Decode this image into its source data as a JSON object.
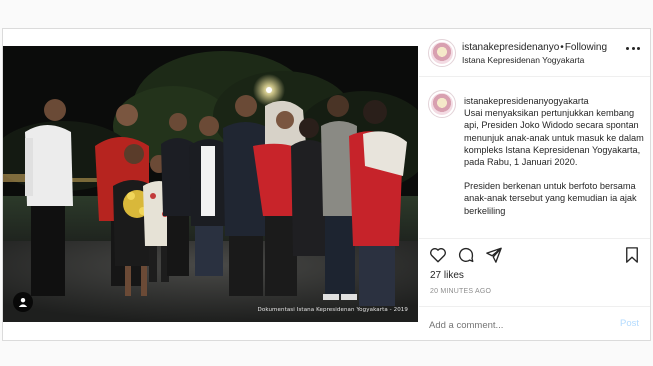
{
  "post": {
    "username": "istanakepresidenanyogyakarta",
    "header_username": "istanakepresidenanyo",
    "follow_label": "Following",
    "separator": "•",
    "location": "Istana Kepresidenan Yogyakarta",
    "caption_username": "istanakepresidenanyogyakarta",
    "caption_p1": "Usai menyaksikan pertunjukkan kembang api, Presiden Joko Widodo secara spontan menunjuk anak-anak untuk masuk ke dalam kompleks Istana Kepresidenan Yogyakarta, pada Rabu, 1 Januari 2020.",
    "caption_p2": "Presiden berkenan untuk berfoto bersama anak-anak tersebut yang kemudian ia ajak berkeliling",
    "likes": "27 likes",
    "time": "20 MINUTES AGO",
    "comment_placeholder": "Add a comment...",
    "post_label": "Post"
  },
  "photo": {
    "credit": "Dokumentasi Istana Kepresidenan Yogyakarta - 2019"
  },
  "icons": {
    "more": "more-options-icon",
    "like": "heart-icon",
    "comment": "comment-icon",
    "share": "share-icon",
    "save": "bookmark-icon",
    "photo_user": "tagged-user-icon"
  },
  "colors": {
    "post_button": "#b3dbff",
    "secondary_text": "#8e8e8e",
    "border": "#dbdbdb"
  }
}
